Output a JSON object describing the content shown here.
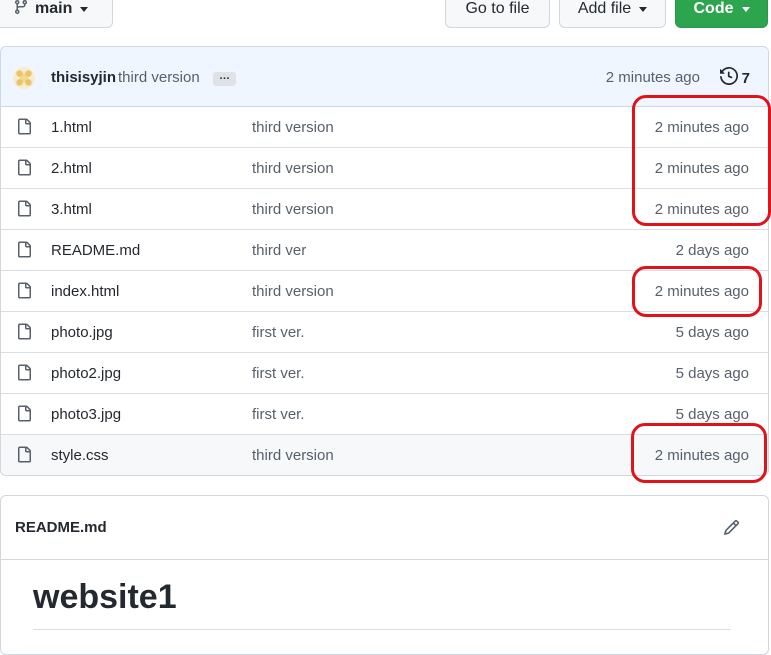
{
  "toolbar": {
    "branch": "main",
    "go_to_file": "Go to file",
    "add_file": "Add file",
    "code": "Code"
  },
  "commit": {
    "author": "thisisyjin",
    "message": "third version",
    "ellipsis": "…",
    "time": "2 minutes ago",
    "history_count": "7"
  },
  "files": [
    {
      "name": "1.html",
      "message": "third version",
      "age": "2 minutes ago"
    },
    {
      "name": "2.html",
      "message": "third version",
      "age": "2 minutes ago"
    },
    {
      "name": "3.html",
      "message": "third version",
      "age": "2 minutes ago"
    },
    {
      "name": "README.md",
      "message": "third ver",
      "age": "2 days ago"
    },
    {
      "name": "index.html",
      "message": "third version",
      "age": "2 minutes ago"
    },
    {
      "name": "photo.jpg",
      "message": "first ver.",
      "age": "5 days ago"
    },
    {
      "name": "photo2.jpg",
      "message": "first ver.",
      "age": "5 days ago"
    },
    {
      "name": "photo3.jpg",
      "message": "first ver.",
      "age": "5 days ago"
    },
    {
      "name": "style.css",
      "message": "third version",
      "age": "2 minutes ago"
    }
  ],
  "readme": {
    "filename": "README.md",
    "heading": "website1"
  },
  "colors": {
    "accent_green": "#2da44e",
    "annotation_red": "#e0121b",
    "commit_bar_bg": "#f0f6ff"
  }
}
